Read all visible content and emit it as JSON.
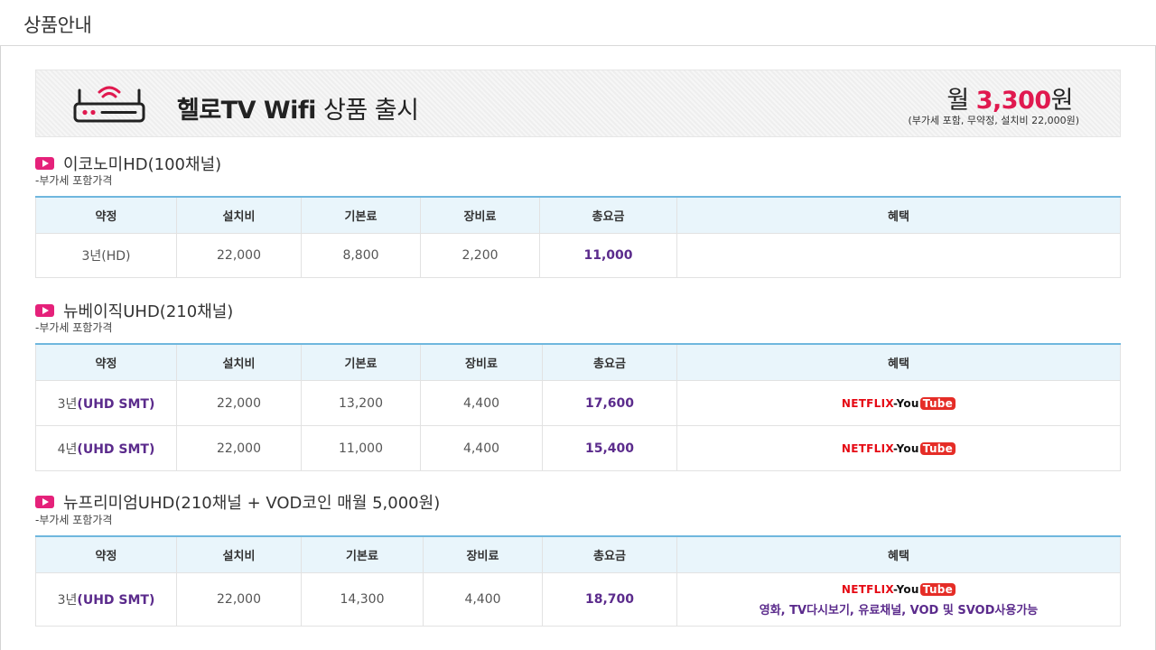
{
  "page": {
    "title": "상품안내"
  },
  "banner": {
    "icon": "wifi-router-icon",
    "headline_bold": "헬로TV Wifi",
    "headline_light": " 상품 출시",
    "price_prefix": "월 ",
    "price_number": "3,300",
    "price_suffix": "원",
    "price_note": "(부가세 포함, 무약정, 설치비 22,000원)"
  },
  "headers": [
    "약정",
    "설치비",
    "기본료",
    "장비료",
    "총요금",
    "혜택"
  ],
  "sections": [
    {
      "title": "이코노미HD(100채널)",
      "note": "-부가세 포함가격",
      "rows": [
        {
          "term_num": "3년",
          "term_type": "(HD)",
          "install": "22,000",
          "base": "8,800",
          "equip": "2,200",
          "total": "11,000"
        }
      ]
    },
    {
      "title": "뉴베이직UHD(210채널)",
      "note": "-부가세 포함가격",
      "rows": [
        {
          "term_num": "3년",
          "term_type": "(UHD SMT)",
          "install": "22,000",
          "base": "13,200",
          "equip": "4,400",
          "total": "17,600"
        },
        {
          "term_num": "4년",
          "term_type": "(UHD SMT)",
          "install": "22,000",
          "base": "11,000",
          "equip": "4,400",
          "total": "15,400"
        }
      ]
    },
    {
      "title": "뉴프리미엄UHD(210채널 + VOD코인 매월 5,000원)",
      "note": "-부가세 포함가격",
      "rows": [
        {
          "term_num": "3년",
          "term_type": "(UHD SMT)",
          "install": "22,000",
          "base": "14,300",
          "equip": "4,400",
          "total": "18,700",
          "benefit_text": "영화, TV다시보기, 유료채널, VOD 및 SVOD사용가능"
        }
      ]
    }
  ],
  "benefit_logo": {
    "netflix": "NETFLIX",
    "sep": "-",
    "you": "You",
    "tube": "Tube"
  },
  "colors": {
    "accent_pink": "#e5217a",
    "price_red": "#e0194f",
    "total_purple": "#5b2b8c",
    "table_top": "#6fb7de"
  }
}
